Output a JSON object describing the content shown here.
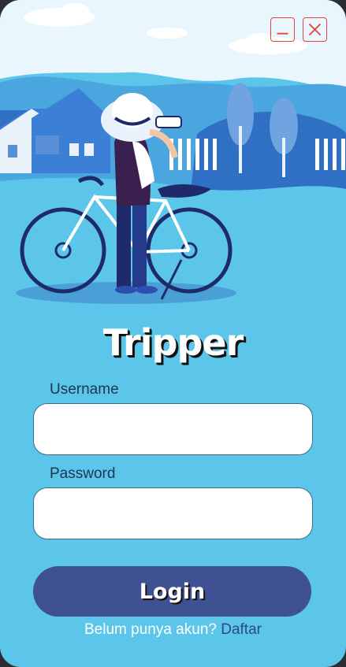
{
  "window": {
    "minimize_icon": "minimize-icon",
    "close_icon": "close-icon",
    "control_color": "#e0453a"
  },
  "hero": {
    "illustration": "person-with-bicycle-binoculars"
  },
  "app": {
    "title": "Tripper"
  },
  "form": {
    "username_label": "Username",
    "username_value": "",
    "password_label": "Password",
    "password_value": "",
    "login_label": "Login"
  },
  "signup": {
    "prompt": "Belum punya akun?",
    "link_label": "Daftar"
  },
  "colors": {
    "background": "#5bc6ea",
    "button": "#3f5192",
    "link": "#2a4a86"
  }
}
